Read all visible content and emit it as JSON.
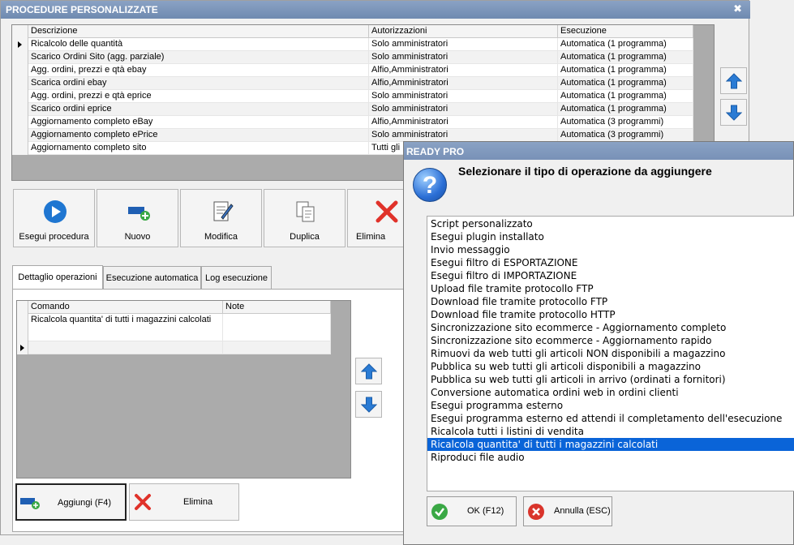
{
  "main": {
    "title": "PROCEDURE PERSONALIZZATE",
    "close_glyph": "✖",
    "grid": {
      "headers": [
        "Descrizione",
        "Autorizzazioni",
        "Esecuzione"
      ],
      "rows": [
        [
          "Ricalcolo delle quantità",
          "Solo amministratori",
          "Automatica (1 programma)"
        ],
        [
          "Scarico Ordini Sito (agg. parziale)",
          "Solo amministratori",
          "Automatica (1 programma)"
        ],
        [
          "Agg. ordini, prezzi e qtà ebay",
          "Alfio,Amministratori",
          "Automatica (1 programma)"
        ],
        [
          "Scarica ordini ebay",
          "Alfio,Amministratori",
          "Automatica (1 programma)"
        ],
        [
          "Agg. ordini, prezzi e qtà eprice",
          "Solo amministratori",
          "Automatica (1 programma)"
        ],
        [
          "Scarico ordini eprice",
          "Solo amministratori",
          "Automatica (1 programma)"
        ],
        [
          "Aggiornamento completo eBay",
          "Alfio,Amministratori",
          "Automatica (3 programmi)"
        ],
        [
          "Aggiornamento completo ePrice",
          "Solo amministratori",
          "Automatica (3 programmi)"
        ],
        [
          "Aggiornamento completo sito",
          "Tutti gli",
          ""
        ]
      ]
    },
    "toolbar": {
      "run_label": "Esegui procedura",
      "new_label": "Nuovo",
      "edit_label": "Modifica",
      "duplicate_label": "Duplica",
      "delete_label": "Elimina"
    },
    "tabs": [
      {
        "label": "Dettaglio operazioni"
      },
      {
        "label": "Esecuzione automatica"
      },
      {
        "label": "Log esecuzione"
      }
    ],
    "ops_grid": {
      "headers": [
        "Comando",
        "Note"
      ],
      "rows": [
        [
          "Ricalcola quantita' di tutti i magazzini calcolati",
          ""
        ]
      ]
    },
    "bottom": {
      "add_label": "Aggiungi (F4)",
      "delete_label": "Elimina"
    }
  },
  "dialog": {
    "title": "READY PRO",
    "heading": "Selezionare il tipo di operazione da aggiungere",
    "options": [
      "Script personalizzato",
      "Esegui plugin installato",
      "Invio messaggio",
      "Esegui filtro di ESPORTAZIONE",
      "Esegui filtro di IMPORTAZIONE",
      "Upload file tramite protocollo FTP",
      "Download file tramite protocollo FTP",
      "Download file tramite protocollo HTTP",
      "Sincronizzazione sito ecommerce - Aggiornamento completo",
      "Sincronizzazione sito ecommerce - Aggiornamento rapido",
      "Rimuovi da web tutti gli articoli NON disponibili a magazzino",
      "Pubblica su web tutti gli articoli disponibili a magazzino",
      "Pubblica su web tutti gli articoli in arrivo (ordinati a fornitori)",
      "Conversione automatica ordini web in ordini clienti",
      "Esegui programma esterno",
      "Esegui programma esterno ed attendi il completamento dell'esecuzione",
      "Ricalcola tutti i listini di vendita",
      "Ricalcola quantita' di tutti i magazzini calcolati",
      "Riproduci file audio"
    ],
    "selected_index": 17,
    "ok_label": "OK (F12)",
    "cancel_label": "Annulla (ESC)",
    "question_glyph": "?"
  },
  "colors": {
    "titlebar": "#7891b7",
    "selection": "#0a64d8",
    "arrow_blue": "#2a7bd4",
    "delete_red": "#e0322a",
    "ok_green": "#3aa845",
    "cancel_red": "#d9342b"
  }
}
